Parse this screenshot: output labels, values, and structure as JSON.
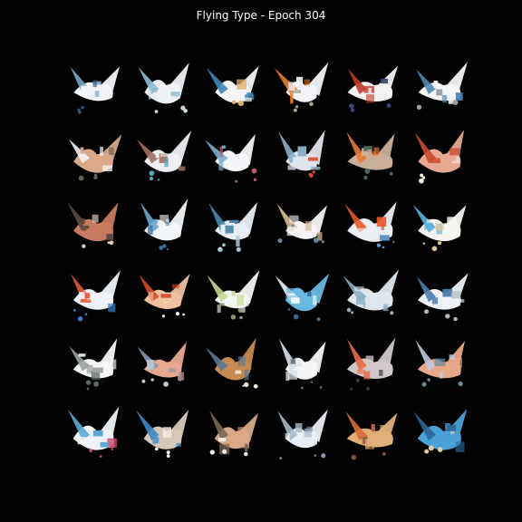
{
  "figure": {
    "title": "Flying Type - Epoch 304",
    "grid": {
      "rows": 6,
      "cols": 6
    },
    "background_color": "#020202",
    "samples": [
      {
        "row": 1,
        "col": 1,
        "colors": [
          "#f2f4f8",
          "#7aa8c8",
          "#2f5670"
        ]
      },
      {
        "row": 1,
        "col": 2,
        "colors": [
          "#eef0f4",
          "#8fbcd0",
          "#c8d6e0"
        ]
      },
      {
        "row": 1,
        "col": 3,
        "colors": [
          "#f4f4f4",
          "#3d86b8",
          "#e0b070"
        ]
      },
      {
        "row": 1,
        "col": 4,
        "colors": [
          "#f0f2f6",
          "#e87a28",
          "#a8a890"
        ]
      },
      {
        "row": 1,
        "col": 5,
        "colors": [
          "#f2f2f2",
          "#c23a2a",
          "#3a4470"
        ]
      },
      {
        "row": 1,
        "col": 6,
        "colors": [
          "#f4f4f4",
          "#4c88b0",
          "#9aa0a8"
        ]
      },
      {
        "row": 2,
        "col": 1,
        "colors": [
          "#d8a888",
          "#f4f4f4",
          "#6a6050"
        ]
      },
      {
        "row": 2,
        "col": 2,
        "colors": [
          "#eceef2",
          "#a07060",
          "#5aa0c0"
        ]
      },
      {
        "row": 2,
        "col": 3,
        "colors": [
          "#f2f4f8",
          "#7ab0d0",
          "#c05a70"
        ]
      },
      {
        "row": 2,
        "col": 4,
        "colors": [
          "#dfe4ea",
          "#8ab0c8",
          "#d84a30"
        ]
      },
      {
        "row": 2,
        "col": 5,
        "colors": [
          "#c8b098",
          "#e87838",
          "#4a6a58"
        ]
      },
      {
        "row": 2,
        "col": 6,
        "colors": [
          "#e8a890",
          "#c84a30",
          "#f4f0e8"
        ]
      },
      {
        "row": 3,
        "col": 1,
        "colors": [
          "#c87a60",
          "#5a4a40",
          "#d8c8b0"
        ]
      },
      {
        "row": 3,
        "col": 2,
        "colors": [
          "#f0f4f8",
          "#6aa8d0",
          "#3a70a0"
        ]
      },
      {
        "row": 3,
        "col": 3,
        "colors": [
          "#e8eef4",
          "#4a88b0",
          "#a8c8d8"
        ]
      },
      {
        "row": 3,
        "col": 4,
        "colors": [
          "#f4f4f4",
          "#d8b890",
          "#6a8898"
        ]
      },
      {
        "row": 3,
        "col": 5,
        "colors": [
          "#eaeef2",
          "#e85a2a",
          "#5a98c8"
        ]
      },
      {
        "row": 3,
        "col": 6,
        "colors": [
          "#f4f4f0",
          "#5ab0d8",
          "#e0c890"
        ]
      },
      {
        "row": 4,
        "col": 1,
        "colors": [
          "#eef2f6",
          "#e85a3a",
          "#3a78c0"
        ]
      },
      {
        "row": 4,
        "col": 2,
        "colors": [
          "#f0c0a0",
          "#d84a2a",
          "#f4f0e8"
        ]
      },
      {
        "row": 4,
        "col": 3,
        "colors": [
          "#f2f4f0",
          "#c8d890",
          "#8a9a70"
        ]
      },
      {
        "row": 4,
        "col": 4,
        "colors": [
          "#6ab8e0",
          "#f0f4f8",
          "#3a6890"
        ]
      },
      {
        "row": 4,
        "col": 5,
        "colors": [
          "#dfe6ee",
          "#8ab0c8",
          "#a0a8b0"
        ]
      },
      {
        "row": 4,
        "col": 6,
        "colors": [
          "#eef2f6",
          "#4a80b0",
          "#b0b8c0"
        ]
      },
      {
        "row": 5,
        "col": 1,
        "colors": [
          "#f4f4f4",
          "#9aa0a0",
          "#606860"
        ]
      },
      {
        "row": 5,
        "col": 2,
        "colors": [
          "#e8a890",
          "#8a98b0",
          "#c0c8d0"
        ]
      },
      {
        "row": 5,
        "col": 3,
        "colors": [
          "#c88a50",
          "#5a7890",
          "#f0e8d8"
        ]
      },
      {
        "row": 5,
        "col": 4,
        "colors": [
          "#f4f4f4",
          "#d8e0e8",
          "#6a7888"
        ]
      },
      {
        "row": 5,
        "col": 5,
        "colors": [
          "#d0c8c8",
          "#e86a4a",
          "#3a3840"
        ]
      },
      {
        "row": 5,
        "col": 6,
        "colors": [
          "#e8a888",
          "#c0c8d8",
          "#6a8898"
        ]
      },
      {
        "row": 6,
        "col": 1,
        "colors": [
          "#eef2f6",
          "#5aa8d8",
          "#c84a6a"
        ]
      },
      {
        "row": 6,
        "col": 2,
        "colors": [
          "#d8c8b8",
          "#3a88c8",
          "#f0e8e0"
        ]
      },
      {
        "row": 6,
        "col": 3,
        "colors": [
          "#d8a888",
          "#7a6858",
          "#f0ece8"
        ]
      },
      {
        "row": 6,
        "col": 4,
        "colors": [
          "#e8eef4",
          "#a8b8c8",
          "#8a98a8"
        ]
      },
      {
        "row": 6,
        "col": 5,
        "colors": [
          "#e0b078",
          "#d86a3a",
          "#7a5040"
        ]
      },
      {
        "row": 6,
        "col": 6,
        "colors": [
          "#4aa0d8",
          "#2a6898",
          "#e0c8a0"
        ]
      }
    ]
  }
}
